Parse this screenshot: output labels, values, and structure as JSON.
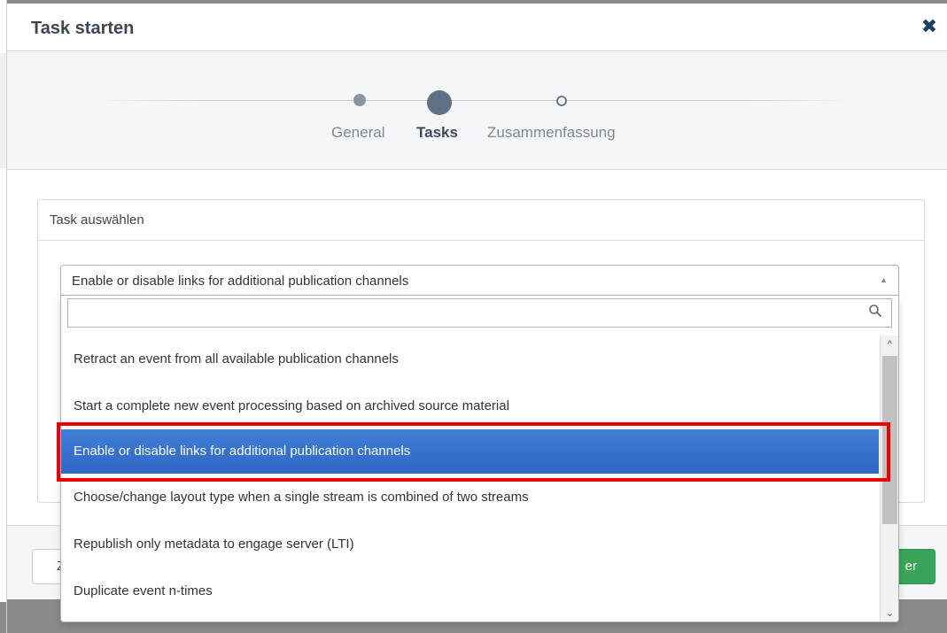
{
  "modal": {
    "title": "Task starten",
    "close_icon": "close-icon"
  },
  "wizard": {
    "steps": [
      {
        "label": "General",
        "state": "done"
      },
      {
        "label": "Tasks",
        "state": "active"
      },
      {
        "label": "Zusammenfassung",
        "state": "pending"
      }
    ]
  },
  "panel": {
    "header": "Task auswählen"
  },
  "select": {
    "selected_value": "Enable or disable links for additional publication channels",
    "search_value": "",
    "search_icon": "search-icon",
    "options": [
      "Retract an event from all available publication channels",
      "Start a complete new event processing based on archived source material",
      "Enable or disable links for additional publication channels",
      "Choose/change layout type when a single stream is combined of two streams",
      "Republish only metadata to engage server (LTI)",
      "Duplicate event n-times"
    ],
    "highlighted_index": 2
  },
  "footer": {
    "back_label": "Z",
    "next_label": "er"
  },
  "colors": {
    "accent": "#2f67c4",
    "success": "#3aa55a",
    "highlight_outline": "#ee0000"
  }
}
